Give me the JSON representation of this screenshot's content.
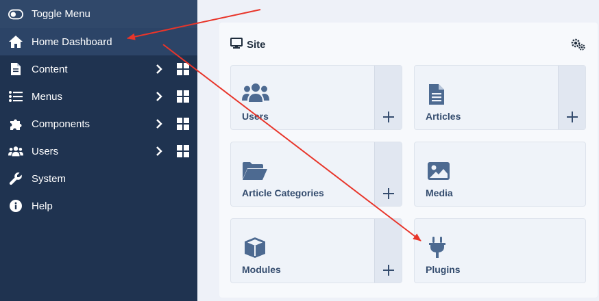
{
  "sidebar": {
    "toggle_label": "Toggle Menu",
    "home_label": "Home Dashboard",
    "items": [
      {
        "label": "Content",
        "icon": "file-icon"
      },
      {
        "label": "Menus",
        "icon": "list-icon"
      },
      {
        "label": "Components",
        "icon": "puzzle-icon"
      },
      {
        "label": "Users",
        "icon": "users-icon"
      },
      {
        "label": "System",
        "icon": "wrench-icon"
      },
      {
        "label": "Help",
        "icon": "info-icon"
      }
    ]
  },
  "panel": {
    "title": "Site",
    "title_icon": "monitor-icon",
    "settings_icon": "gears-icon"
  },
  "tiles": [
    {
      "label": "Users",
      "icon": "users-icon",
      "has_add": true
    },
    {
      "label": "Articles",
      "icon": "file-text-icon",
      "has_add": true
    },
    {
      "label": "Article Categories",
      "icon": "folder-open-icon",
      "has_add": true
    },
    {
      "label": "Media",
      "icon": "image-icon",
      "has_add": false
    },
    {
      "label": "Modules",
      "icon": "cube-icon",
      "has_add": true
    },
    {
      "label": "Plugins",
      "icon": "plug-icon",
      "has_add": false
    }
  ],
  "colors": {
    "sidebar_bg": "#1f3350",
    "sidebar_active": "#30486a",
    "tile_bg": "#eff3f9",
    "tile_text": "#344c6e",
    "annotation_arrow": "#e8352a"
  }
}
